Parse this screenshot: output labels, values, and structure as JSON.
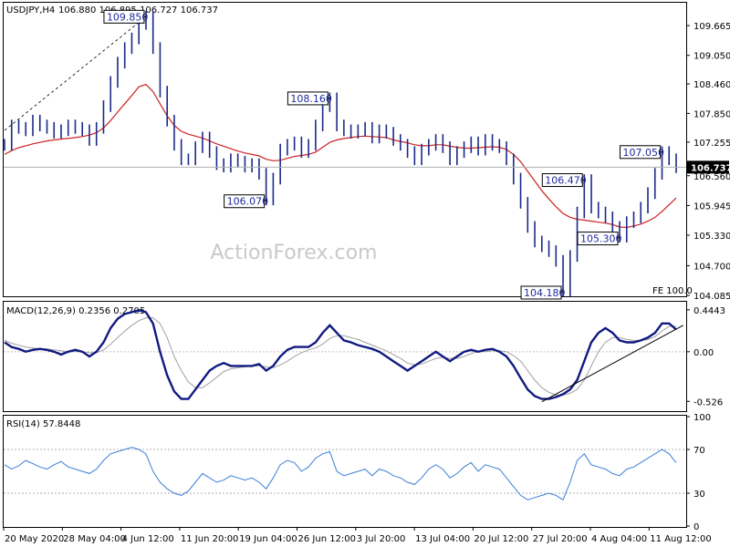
{
  "chart_data": {
    "type": "line",
    "header": {
      "symbol": "USDJPY,H4",
      "ohlc": "106.880 106.895 106.727 106.737"
    },
    "colors": {
      "price": "#1a2a8a",
      "ma": "#cc2222",
      "macd": "#101a80",
      "signal": "#a0a0a0",
      "rsi": "#3b7fd9",
      "annotation": "#1f2a9e"
    },
    "x_labels": [
      "20 May 2020",
      "28 May 04:00",
      "4 Jun 12:00",
      "11 Jun 20:00",
      "19 Jun 04:00",
      "26 Jun 12:00",
      "3 Jul 20:00",
      "13 Jul 04:00",
      "20 Jul 12:00",
      "27 Jul 20:00",
      "4 Aug 04:00",
      "11 Aug 12:00"
    ],
    "price_panel": {
      "ylim": [
        104.085,
        110.12
      ],
      "y_ticks": [
        "109.665",
        "109.050",
        "108.460",
        "107.850",
        "107.255",
        "106.560",
        "105.945",
        "105.330",
        "104.700",
        "104.085"
      ],
      "current_price": "106.737",
      "fe_label": "FE 100.0",
      "watermark": "ActionForex.com",
      "close_values": [
        107.2,
        107.6,
        107.55,
        107.5,
        107.7,
        107.6,
        107.55,
        107.45,
        107.5,
        107.6,
        107.55,
        107.5,
        107.3,
        107.55,
        108.0,
        108.5,
        108.9,
        109.2,
        109.4,
        109.7,
        109.85,
        109.2,
        108.3,
        107.7,
        107.2,
        106.9,
        106.9,
        107.15,
        107.35,
        107.05,
        106.8,
        106.75,
        106.9,
        106.85,
        106.75,
        106.8,
        106.6,
        106.07,
        106.5,
        107.1,
        107.2,
        107.25,
        107.05,
        107.2,
        107.6,
        108.0,
        108.16,
        107.6,
        107.5,
        107.45,
        107.5,
        107.55,
        107.35,
        107.5,
        107.45,
        107.3,
        107.2,
        107.05,
        106.9,
        107.1,
        107.2,
        107.3,
        107.15,
        106.9,
        107.05,
        107.15,
        107.25,
        107.1,
        107.3,
        107.2,
        107.15,
        106.9,
        106.5,
        106.0,
        105.5,
        105.2,
        105.1,
        105.0,
        104.8,
        104.18,
        104.9,
        105.8,
        106.47,
        105.9,
        105.8,
        105.7,
        105.5,
        105.3,
        105.6,
        105.7,
        105.9,
        106.2,
        106.6,
        107.05,
        106.9,
        106.737
      ],
      "ma_values": [
        107.0,
        107.08,
        107.14,
        107.18,
        107.22,
        107.25,
        107.28,
        107.3,
        107.32,
        107.33,
        107.35,
        107.37,
        107.4,
        107.45,
        107.55,
        107.7,
        107.88,
        108.05,
        108.22,
        108.4,
        108.45,
        108.3,
        108.05,
        107.8,
        107.6,
        107.48,
        107.42,
        107.38,
        107.34,
        107.28,
        107.22,
        107.17,
        107.12,
        107.07,
        107.03,
        107.0,
        106.97,
        106.9,
        106.87,
        106.88,
        106.92,
        106.96,
        106.98,
        107.0,
        107.05,
        107.15,
        107.25,
        107.3,
        107.33,
        107.35,
        107.37,
        107.38,
        107.37,
        107.36,
        107.35,
        107.3,
        107.27,
        107.24,
        107.2,
        107.18,
        107.18,
        107.2,
        107.2,
        107.17,
        107.15,
        107.13,
        107.13,
        107.14,
        107.15,
        107.16,
        107.15,
        107.1,
        107.0,
        106.85,
        106.65,
        106.45,
        106.25,
        106.08,
        105.92,
        105.78,
        105.7,
        105.66,
        105.64,
        105.62,
        105.6,
        105.58,
        105.55,
        105.5,
        105.49,
        105.52,
        105.56,
        105.62,
        105.7,
        105.82,
        105.96,
        106.1
      ]
    },
    "annotations": [
      {
        "text": "109.850",
        "at": 20
      },
      {
        "text": "106.070",
        "at": 37
      },
      {
        "text": "108.160",
        "at": 46
      },
      {
        "text": "104.180",
        "at": 79
      },
      {
        "text": "106.470",
        "at": 82
      },
      {
        "text": "105.300",
        "at": 87
      },
      {
        "text": "107.050",
        "at": 93
      }
    ],
    "macd_panel": {
      "title": "MACD(12,26,9) 0.2356 0.2705",
      "ylim": [
        -0.62,
        0.52
      ],
      "y_ticks": [
        "0.4443",
        "0.00",
        "-0.526"
      ],
      "zero_tick": "0.00",
      "macd_values": [
        0.1,
        0.05,
        0.03,
        0.0,
        0.02,
        0.03,
        0.02,
        0.0,
        -0.03,
        0.0,
        0.02,
        0.0,
        -0.05,
        0.0,
        0.1,
        0.25,
        0.35,
        0.4,
        0.42,
        0.44,
        0.42,
        0.3,
        0.0,
        -0.25,
        -0.42,
        -0.5,
        -0.5,
        -0.4,
        -0.3,
        -0.2,
        -0.15,
        -0.12,
        -0.15,
        -0.15,
        -0.15,
        -0.15,
        -0.13,
        -0.2,
        -0.15,
        -0.05,
        0.02,
        0.05,
        0.05,
        0.05,
        0.1,
        0.2,
        0.28,
        0.2,
        0.12,
        0.1,
        0.07,
        0.05,
        0.03,
        0.0,
        -0.05,
        -0.1,
        -0.15,
        -0.2,
        -0.15,
        -0.1,
        -0.05,
        0.0,
        -0.05,
        -0.1,
        -0.05,
        0.0,
        0.02,
        0.0,
        0.02,
        0.03,
        0.0,
        -0.05,
        -0.15,
        -0.28,
        -0.4,
        -0.47,
        -0.5,
        -0.5,
        -0.48,
        -0.45,
        -0.4,
        -0.3,
        -0.1,
        0.1,
        0.2,
        0.25,
        0.2,
        0.12,
        0.1,
        0.1,
        0.12,
        0.15,
        0.2,
        0.3,
        0.3,
        0.2356
      ],
      "signal_values": [
        0.12,
        0.09,
        0.07,
        0.05,
        0.04,
        0.03,
        0.03,
        0.02,
        0.01,
        0.0,
        0.0,
        0.0,
        -0.01,
        -0.01,
        0.02,
        0.08,
        0.15,
        0.22,
        0.28,
        0.33,
        0.36,
        0.36,
        0.3,
        0.15,
        -0.05,
        -0.2,
        -0.32,
        -0.38,
        -0.38,
        -0.33,
        -0.27,
        -0.21,
        -0.18,
        -0.17,
        -0.16,
        -0.15,
        -0.15,
        -0.16,
        -0.17,
        -0.14,
        -0.1,
        -0.05,
        -0.01,
        0.02,
        0.04,
        0.08,
        0.14,
        0.17,
        0.17,
        0.15,
        0.13,
        0.1,
        0.07,
        0.04,
        0.01,
        -0.03,
        -0.07,
        -0.12,
        -0.14,
        -0.13,
        -0.1,
        -0.07,
        -0.06,
        -0.07,
        -0.07,
        -0.05,
        -0.02,
        0.0,
        0.0,
        0.01,
        0.01,
        0.0,
        -0.04,
        -0.1,
        -0.2,
        -0.3,
        -0.38,
        -0.43,
        -0.46,
        -0.46,
        -0.44,
        -0.4,
        -0.3,
        -0.15,
        0.0,
        0.1,
        0.15,
        0.15,
        0.13,
        0.12,
        0.12,
        0.13,
        0.16,
        0.22,
        0.27,
        0.2705
      ],
      "trendline": {
        "from": [
          76,
          -0.53
        ],
        "to": [
          96,
          0.28
        ]
      }
    },
    "rsi_panel": {
      "title": "RSI(14) 57.8448",
      "ylim": [
        0,
        100
      ],
      "y_ticks": [
        "100",
        "70",
        "30",
        "0"
      ],
      "levels": [
        70,
        30
      ],
      "values": [
        56,
        52,
        55,
        60,
        57,
        54,
        52,
        56,
        59,
        54,
        52,
        50,
        48,
        52,
        60,
        66,
        68,
        70,
        72,
        70,
        66,
        50,
        40,
        34,
        30,
        28,
        32,
        40,
        48,
        44,
        40,
        42,
        46,
        44,
        42,
        44,
        40,
        34,
        44,
        56,
        60,
        58,
        50,
        54,
        62,
        66,
        68,
        50,
        46,
        48,
        50,
        52,
        46,
        52,
        50,
        46,
        44,
        40,
        38,
        44,
        52,
        56,
        52,
        44,
        48,
        54,
        58,
        50,
        56,
        54,
        52,
        44,
        36,
        28,
        24,
        26,
        28,
        30,
        28,
        24,
        40,
        60,
        66,
        56,
        54,
        52,
        48,
        46,
        52,
        54,
        58,
        62,
        66,
        70,
        66,
        57.8448
      ]
    }
  }
}
